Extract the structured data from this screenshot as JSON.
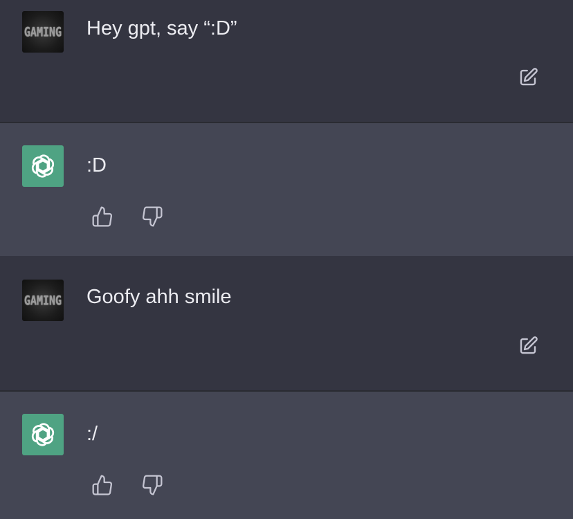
{
  "colors": {
    "user_bg": "#343541",
    "assistant_bg": "#444654",
    "text": "#ececf1",
    "icon": "#c5c5d2",
    "bot_avatar_bg": "#4fa383"
  },
  "messages": [
    {
      "role": "user",
      "text": "Hey gpt, say “:D”",
      "avatar_text": "GAMING",
      "edit_icon": "edit-icon"
    },
    {
      "role": "assistant",
      "text": ":D",
      "avatar_icon": "openai-logo-icon",
      "feedback_icons": [
        "thumbs-up-icon",
        "thumbs-down-icon"
      ]
    },
    {
      "role": "user",
      "text": "Goofy ahh smile",
      "avatar_text": "GAMING",
      "edit_icon": "edit-icon"
    },
    {
      "role": "assistant",
      "text": ":/",
      "avatar_icon": "openai-logo-icon",
      "feedback_icons": [
        "thumbs-up-icon",
        "thumbs-down-icon"
      ]
    }
  ]
}
